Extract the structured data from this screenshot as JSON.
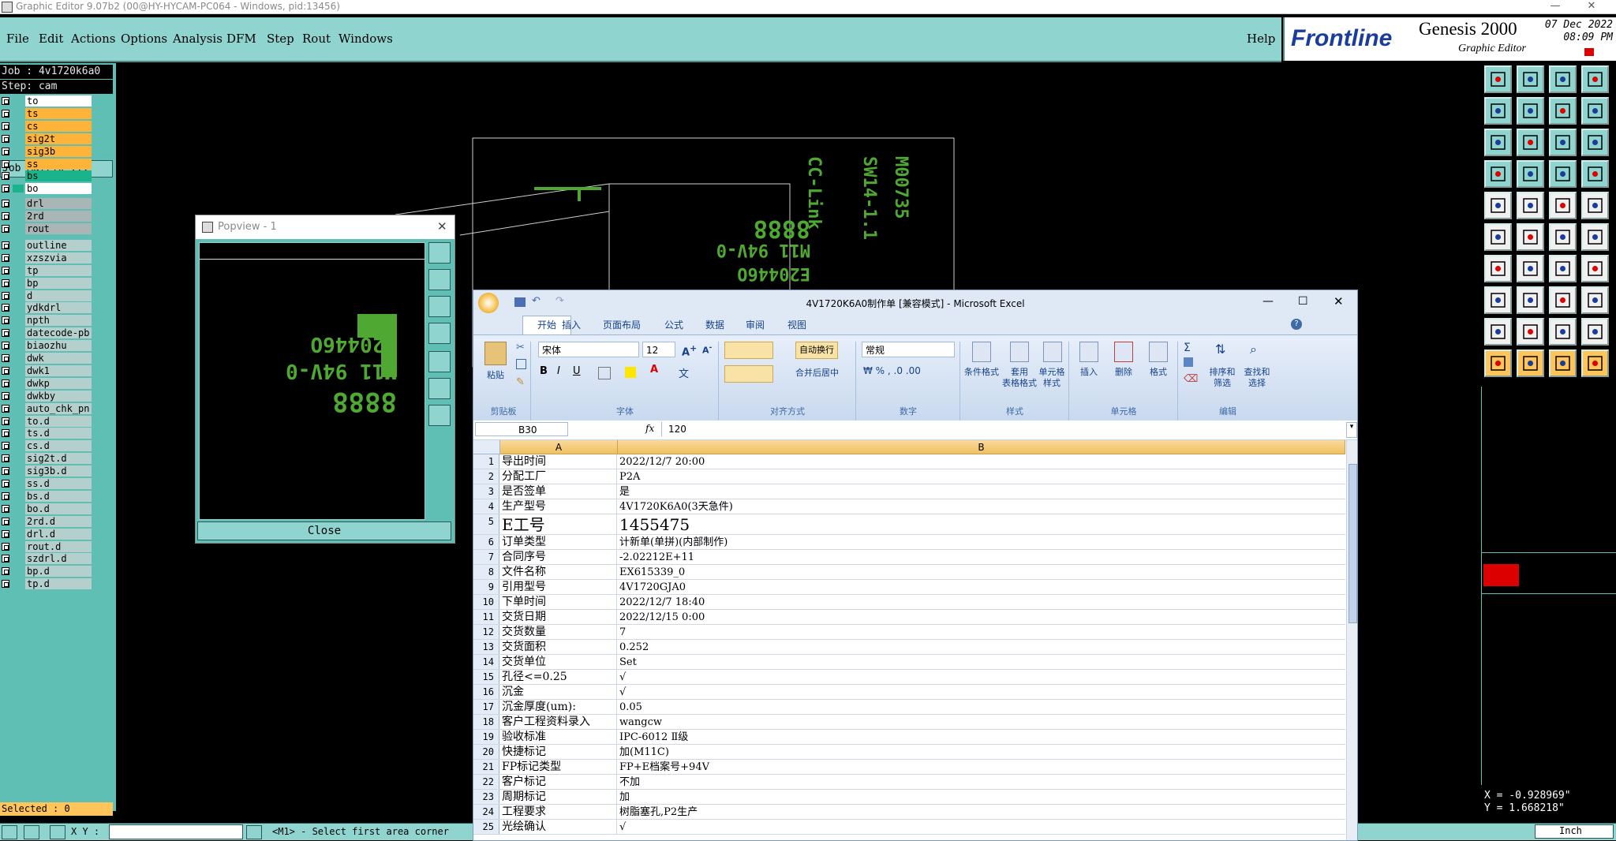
{
  "window": {
    "title": "Graphic Editor 9.07b2 (00@HY-HYCAM-PC064 - Windows, pid:13456)"
  },
  "menu": {
    "items": [
      "File",
      "Edit",
      "Actions",
      "Options",
      "Analysis",
      "DFM",
      "Step",
      "Rout",
      "Windows"
    ],
    "help": "Help"
  },
  "brand": {
    "frontline": "Frontline",
    "product": "Genesis 2000",
    "subtitle": "Graphic Editor",
    "date": "07 Dec 2022",
    "time": "08:09 PM"
  },
  "left_panel": {
    "job": "Job : 4v1720k6a0",
    "step": "Step: cam",
    "job_matrix": "Job Matrix ...",
    "layers": [
      {
        "name": "to",
        "color": "white"
      },
      {
        "name": "ts",
        "color": "yellow"
      },
      {
        "name": "cs",
        "color": "yellow"
      },
      {
        "name": "sig2t",
        "color": "yellow"
      },
      {
        "name": "sig3b",
        "color": "yellow"
      },
      {
        "name": "ss",
        "color": "yellow"
      },
      {
        "name": "bs",
        "color": "green"
      },
      {
        "name": "bo",
        "color": "white"
      },
      {
        "name": "drl",
        "color": "slate"
      },
      {
        "name": "2rd",
        "color": "slate"
      },
      {
        "name": "rout",
        "color": "slate"
      },
      {
        "name": "outline",
        "color": "light"
      },
      {
        "name": "xzszvia",
        "color": "light"
      },
      {
        "name": "tp",
        "color": "light"
      },
      {
        "name": "bp",
        "color": "light"
      },
      {
        "name": "d",
        "color": "light"
      },
      {
        "name": "ydkdrl",
        "color": "light"
      },
      {
        "name": "npth",
        "color": "light"
      },
      {
        "name": "datecode-pb",
        "color": "light"
      },
      {
        "name": "biaozhu",
        "color": "light"
      },
      {
        "name": "dwk",
        "color": "light"
      },
      {
        "name": "dwk1",
        "color": "light"
      },
      {
        "name": "dwkp",
        "color": "light"
      },
      {
        "name": "dwkby",
        "color": "light"
      },
      {
        "name": "auto_chk_pn",
        "color": "light"
      },
      {
        "name": "to.d",
        "color": "light"
      },
      {
        "name": "ts.d",
        "color": "light"
      },
      {
        "name": "cs.d",
        "color": "light"
      },
      {
        "name": "sig2t.d",
        "color": "light"
      },
      {
        "name": "sig3b.d",
        "color": "light"
      },
      {
        "name": "ss.d",
        "color": "light"
      },
      {
        "name": "bs.d",
        "color": "light"
      },
      {
        "name": "bo.d",
        "color": "light"
      },
      {
        "name": "2rd.d",
        "color": "light"
      },
      {
        "name": "drl.d",
        "color": "light"
      },
      {
        "name": "rout.d",
        "color": "light"
      },
      {
        "name": "szdrl.d",
        "color": "light"
      },
      {
        "name": "bp.d",
        "color": "light"
      },
      {
        "name": "tp.d",
        "color": "light"
      }
    ],
    "selected": "Selected : 0"
  },
  "bottom_bar": {
    "xy_label": "X Y :",
    "status": "<M1> - Select first area corner",
    "units": "Inch"
  },
  "coords": {
    "x": "X = -0.928969\"",
    "y": "Y = 1.668218\""
  },
  "canvas": {
    "silk_lines": [
      "E20446O",
      "M11 94V-0",
      "8888"
    ],
    "silk_vertical": [
      "CC-Link",
      "SW14-1.1",
      "M00735"
    ]
  },
  "popview": {
    "title": "Popview - 1",
    "close_label": "Close"
  },
  "excel": {
    "title": "4V1720K6A0制作单  [兼容模式] - Microsoft Excel",
    "tabs": [
      "开始",
      "插入",
      "页面布局",
      "公式",
      "数据",
      "审阅",
      "视图"
    ],
    "ribbon": {
      "paste": "粘贴",
      "clipboard": "剪贴板",
      "font_name": "宋体",
      "font_size": "12",
      "font_group": "字体",
      "wrap": "自动换行",
      "merge": "合并后居中",
      "align_group": "对齐方式",
      "number_format": "常规",
      "number_group": "数字",
      "cond_format": "条件格式",
      "table_format_1": "套用",
      "table_format_2": "表格格式",
      "cell_style_1": "单元格",
      "cell_style_2": "样式",
      "style_group": "样式",
      "insert": "插入",
      "delete": "删除",
      "format": "格式",
      "cells_group": "单元格",
      "sort_1": "排序和",
      "sort_2": "筛选",
      "find_1": "查找和",
      "find_2": "选择",
      "edit_group": "编辑"
    },
    "name_box": "B30",
    "fx": "fx",
    "formula": "120",
    "col_a": "A",
    "col_b": "B",
    "rows": [
      {
        "n": "1",
        "a": "导出时间",
        "b": "2022/12/7 20:00"
      },
      {
        "n": "2",
        "a": "分配工厂",
        "b": "P2A"
      },
      {
        "n": "3",
        "a": "是否签单",
        "b": "是"
      },
      {
        "n": "4",
        "a": "生产型号",
        "b": "4V1720K6A0(3天急件)"
      },
      {
        "n": "5",
        "a": "E工号",
        "b": "1455475",
        "big": true
      },
      {
        "n": "6",
        "a": "订单类型",
        "b": "计新单(单拼)(内部制作)"
      },
      {
        "n": "7",
        "a": "合同序号",
        "b": "-2.02212E+11"
      },
      {
        "n": "8",
        "a": "文件名称",
        "b": "EX615339_0"
      },
      {
        "n": "9",
        "a": "引用型号",
        "b": "4V1720GJA0"
      },
      {
        "n": "10",
        "a": "下单时间",
        "b": "2022/12/7 18:40"
      },
      {
        "n": "11",
        "a": "交货日期",
        "b": "2022/12/15 0:00"
      },
      {
        "n": "12",
        "a": "交货数量",
        "b": "7"
      },
      {
        "n": "13",
        "a": "交货面积",
        "b": "0.252"
      },
      {
        "n": "14",
        "a": "交货单位",
        "b": "Set"
      },
      {
        "n": "15",
        "a": "孔径<=0.25",
        "b": "√"
      },
      {
        "n": "16",
        "a": "沉金",
        "b": "√"
      },
      {
        "n": "17",
        "a": "沉金厚度(um):",
        "b": "0.05"
      },
      {
        "n": "18",
        "a": "客户工程资料录入",
        "b": "wangcw"
      },
      {
        "n": "19",
        "a": "验收标准",
        "b": "IPC-6012 Ⅱ级"
      },
      {
        "n": "20",
        "a": "快捷标记",
        "b": "加(M11C)"
      },
      {
        "n": "21",
        "a": "FP标记类型",
        "b": "FP+E档案号+94V"
      },
      {
        "n": "22",
        "a": "客户标记",
        "b": "不加"
      },
      {
        "n": "23",
        "a": "周期标记",
        "b": "加"
      },
      {
        "n": "24",
        "a": "工程要求",
        "b": "树脂塞孔,P2生产"
      },
      {
        "n": "25",
        "a": "光绘确认",
        "b": "√"
      }
    ]
  }
}
